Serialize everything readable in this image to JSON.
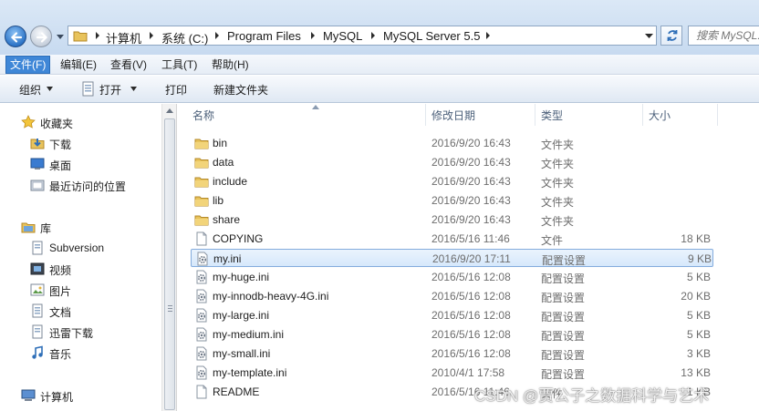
{
  "address": {
    "breadcrumbs": [
      "计算机",
      "系统 (C:)",
      "Program Files",
      "MySQL",
      "MySQL Server 5.5"
    ],
    "search_placeholder": "搜索 MySQL..."
  },
  "menu": [
    "文件(F)",
    "编辑(E)",
    "查看(V)",
    "工具(T)",
    "帮助(H)"
  ],
  "toolbar": {
    "organize": "组织",
    "open": "打开",
    "print": "打印",
    "new_folder": "新建文件夹"
  },
  "nav": {
    "favorites": {
      "label": "收藏夹",
      "items": [
        "下载",
        "桌面",
        "最近访问的位置"
      ]
    },
    "libraries": {
      "label": "库",
      "items": [
        "Subversion",
        "视频",
        "图片",
        "文档",
        "迅雷下载",
        "音乐"
      ]
    },
    "computer": {
      "label": "计算机"
    }
  },
  "columns": {
    "name": "名称",
    "date": "修改日期",
    "type": "类型",
    "size": "大小"
  },
  "files": [
    {
      "name": "bin",
      "date": "2016/9/20 16:43",
      "type": "文件夹",
      "size": "",
      "icon": "folder"
    },
    {
      "name": "data",
      "date": "2016/9/20 16:43",
      "type": "文件夹",
      "size": "",
      "icon": "folder"
    },
    {
      "name": "include",
      "date": "2016/9/20 16:43",
      "type": "文件夹",
      "size": "",
      "icon": "folder"
    },
    {
      "name": "lib",
      "date": "2016/9/20 16:43",
      "type": "文件夹",
      "size": "",
      "icon": "folder"
    },
    {
      "name": "share",
      "date": "2016/9/20 16:43",
      "type": "文件夹",
      "size": "",
      "icon": "folder"
    },
    {
      "name": "COPYING",
      "date": "2016/5/16 11:46",
      "type": "文件",
      "size": "18 KB",
      "icon": "file"
    },
    {
      "name": "my.ini",
      "date": "2016/9/20 17:11",
      "type": "配置设置",
      "size": "9 KB",
      "icon": "config",
      "selected": true
    },
    {
      "name": "my-huge.ini",
      "date": "2016/5/16 12:08",
      "type": "配置设置",
      "size": "5 KB",
      "icon": "config"
    },
    {
      "name": "my-innodb-heavy-4G.ini",
      "date": "2016/5/16 12:08",
      "type": "配置设置",
      "size": "20 KB",
      "icon": "config"
    },
    {
      "name": "my-large.ini",
      "date": "2016/5/16 12:08",
      "type": "配置设置",
      "size": "5 KB",
      "icon": "config"
    },
    {
      "name": "my-medium.ini",
      "date": "2016/5/16 12:08",
      "type": "配置设置",
      "size": "5 KB",
      "icon": "config"
    },
    {
      "name": "my-small.ini",
      "date": "2016/5/16 12:08",
      "type": "配置设置",
      "size": "3 KB",
      "icon": "config"
    },
    {
      "name": "my-template.ini",
      "date": "2010/4/1 17:58",
      "type": "配置设置",
      "size": "13 KB",
      "icon": "config"
    },
    {
      "name": "README",
      "date": "2016/5/16 11:46",
      "type": "文件",
      "size": "1 KB",
      "icon": "file"
    }
  ],
  "watermark": "CSDN @贾公子之数据科学与艺术"
}
